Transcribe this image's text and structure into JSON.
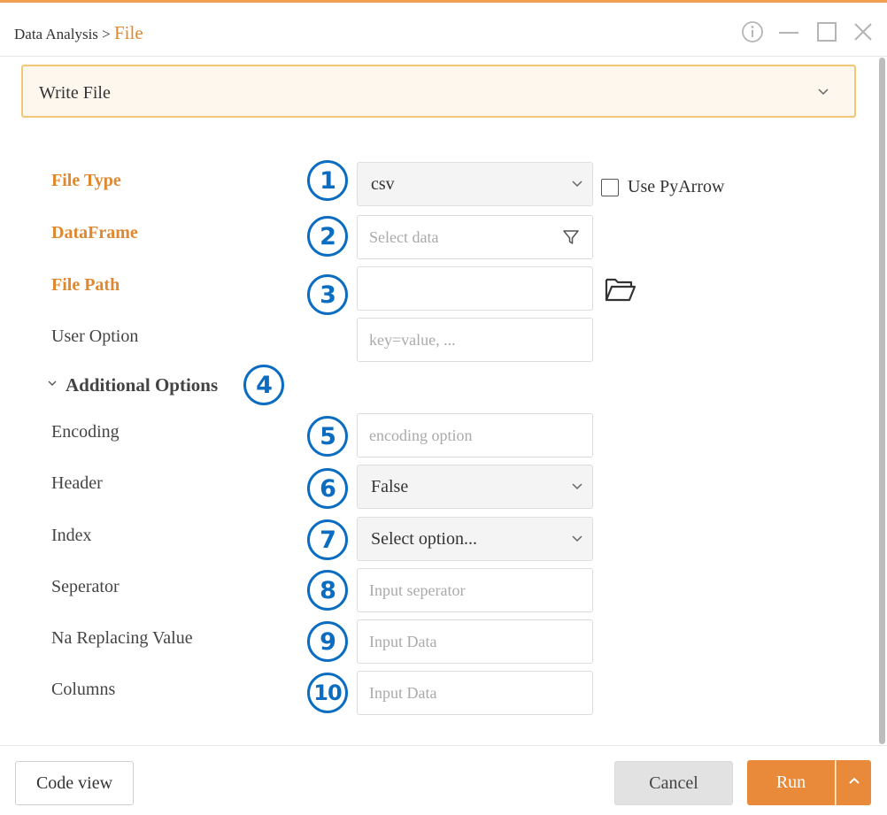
{
  "titlebar": {
    "breadcrumb_parent": "Data Analysis",
    "breadcrumb_sep": ">",
    "breadcrumb_current": "File"
  },
  "top_select": {
    "value": "Write File"
  },
  "form": {
    "file_type": {
      "label": "File Type",
      "value": "csv",
      "badge": "1"
    },
    "use_pyarrow": {
      "label": "Use PyArrow",
      "checked": false
    },
    "dataframe": {
      "label": "DataFrame",
      "placeholder": "Select data",
      "badge": "2"
    },
    "file_path": {
      "label": "File Path",
      "value": "",
      "badge": "3"
    },
    "user_option": {
      "label": "User Option",
      "placeholder": "key=value, ..."
    },
    "additional_options": {
      "label": "Additional Options",
      "badge": "4"
    },
    "encoding": {
      "label": "Encoding",
      "placeholder": "encoding option",
      "badge": "5"
    },
    "header": {
      "label": "Header",
      "value": "False",
      "badge": "6"
    },
    "index": {
      "label": "Index",
      "value": "Select option...",
      "badge": "7"
    },
    "separator": {
      "label": "Seperator",
      "placeholder": "Input seperator",
      "badge": "8"
    },
    "na_replacing": {
      "label": "Na Replacing Value",
      "placeholder": "Input Data",
      "badge": "9"
    },
    "columns": {
      "label": "Columns",
      "placeholder": "Input Data",
      "badge": "10"
    }
  },
  "footer": {
    "code_view": "Code view",
    "cancel": "Cancel",
    "run": "Run"
  },
  "colors": {
    "accent": "#e98a3a",
    "required_label": "#e08830",
    "badge": "#0a6dc2"
  },
  "icons": [
    "info-icon",
    "minimize-icon",
    "maximize-icon",
    "close-icon",
    "chevron-down-icon",
    "filter-icon",
    "folder-icon",
    "chevron-up-icon"
  ]
}
